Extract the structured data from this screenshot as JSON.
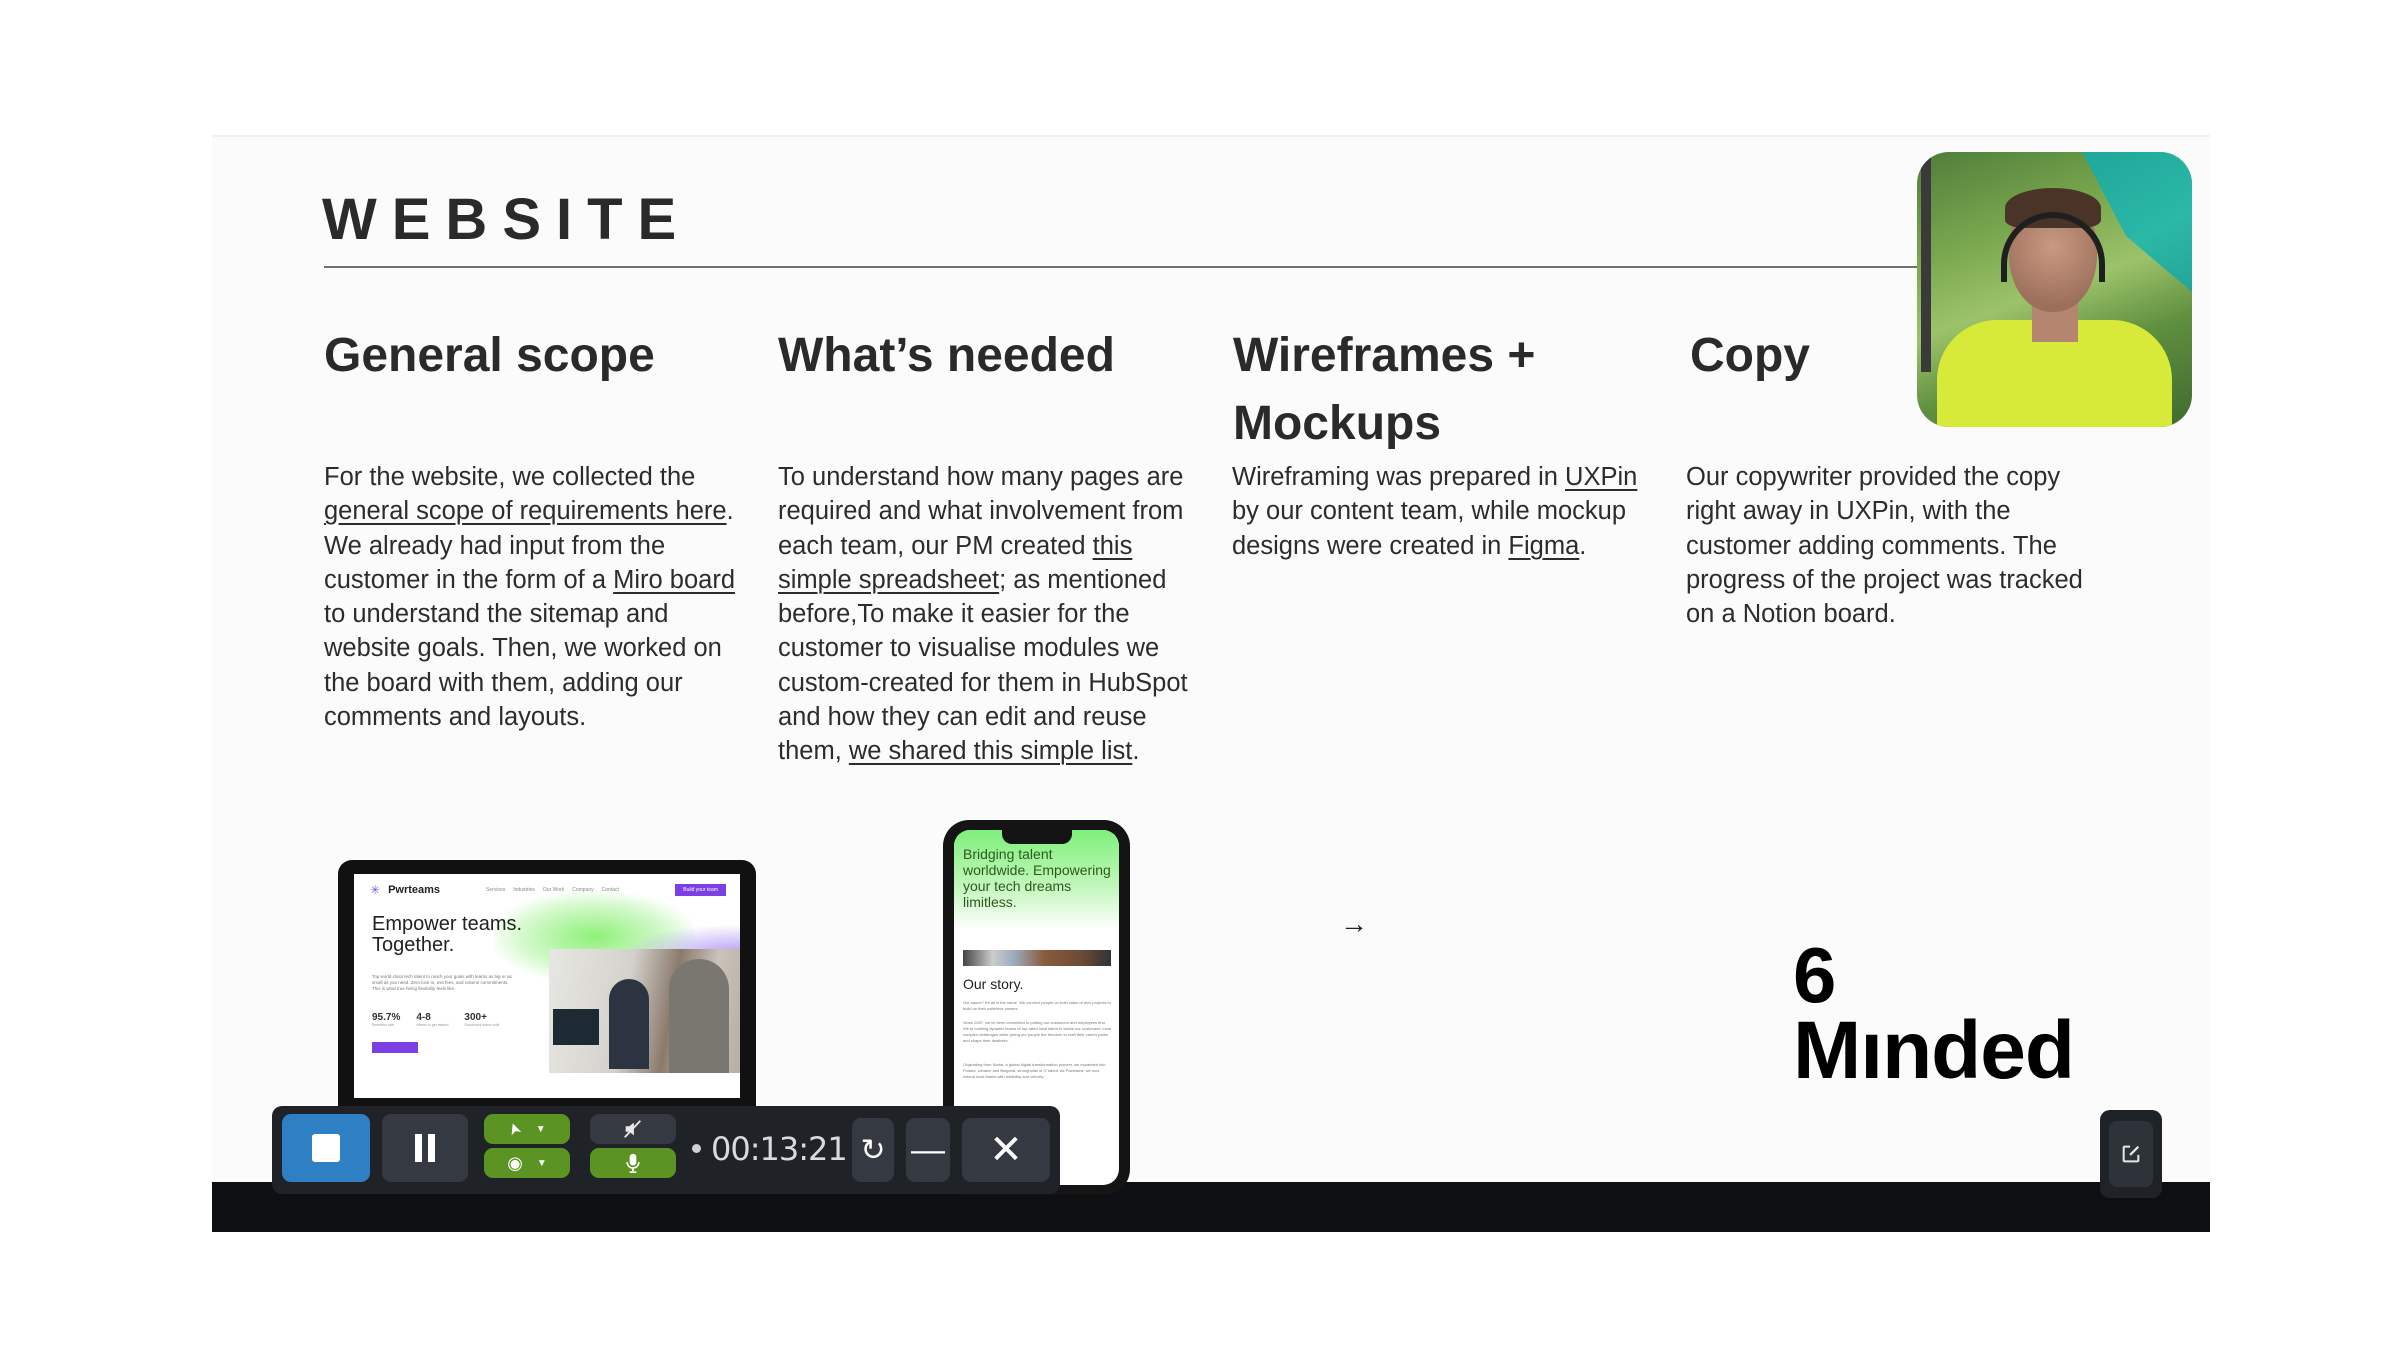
{
  "slide": {
    "title": "WEBSITE",
    "columns": [
      {
        "heading": "General scope",
        "body": [
          {
            "t": "For the website, we collected the "
          },
          {
            "t": "general scope of requirements here",
            "link": true
          },
          {
            "t": ". We already had input from the customer in the form of a "
          },
          {
            "t": "Miro board",
            "link": true
          },
          {
            "t": " to understand the sitemap and website goals. Then, we worked on the board with them, adding our comments and layouts."
          }
        ]
      },
      {
        "heading": "What’s needed",
        "body": [
          {
            "t": "To understand how many pages are required and what involvement from each team, our PM created "
          },
          {
            "t": "this simple spreadsheet",
            "link": true
          },
          {
            "t": "; as mentioned before,To make it easier for the customer to visualise modules we custom-created for them in HubSpot and how they can edit and reuse them, "
          },
          {
            "t": "we shared this simple list",
            "link": true
          },
          {
            "t": "."
          }
        ]
      },
      {
        "heading": "Wireframes + Mockups",
        "body": [
          {
            "t": "Wireframing was prepared in "
          },
          {
            "t": "UXPin",
            "link": true
          },
          {
            "t": " by our content team, while mockup designs were created in "
          },
          {
            "t": "Figma",
            "link": true,
            "blue": true
          },
          {
            "t": "."
          }
        ]
      },
      {
        "heading": "Copy",
        "body": [
          {
            "t": "Our copywriter provided the copy right away in UXPin, with the customer adding comments. The progress of the project was tracked on a Notion board."
          }
        ]
      }
    ],
    "laptop_mockup": {
      "brand": "Pwrteams",
      "nav": [
        "Services",
        "Industries",
        "Our Work",
        "Company",
        "Contact"
      ],
      "cta": "Build your team",
      "hero_line1": "Empower teams.",
      "hero_line2": "Together.",
      "blurb": "Top world-class tech talent to reach your goals with teams as big or as small as you need. Zero lock-in, exit fees, and volume commitments. This is what true hiring flexibility feels like.",
      "stats": [
        {
          "value": "95.7%",
          "label": "Retention rate"
        },
        {
          "value": "4-8",
          "label": "Weeks to get started"
        },
        {
          "value": "300+",
          "label": "Successful teams built"
        }
      ]
    },
    "phone_mockup": {
      "tagline": "Bridging talent worldwide. Empowering your tech dreams limitless.",
      "section_title": "Our story.",
      "paragraphs": [
        "Our sauce? It's all in the name. We connect people on both sides of tech projects to build on their collective powers.",
        "Since 2007, we've been committed to putting our customers and employees first. We're building dynamic teams of top-rated local talent to tackle our customers' most complex challenges while giving our people the freedom to craft their career paths and shape their destinies.",
        "Originating from Nortal, a global digital transformation pioneer, we expanded into Poland, Ukraine and Bulgaria, strongholds of IT talent. As Pwrteams, we now extend local teams with reliability and velocity."
      ]
    },
    "logo": {
      "line1": "6",
      "line2": "Mınded"
    },
    "arrow_icon": "→"
  },
  "webcam": {
    "label": "presenter-webcam"
  },
  "recorder_toolbar": {
    "timer": "00:13:21",
    "stop_color": "#2f7fc5",
    "active_color": "#5b9423",
    "icons": {
      "stop": "■",
      "cursor": "➤",
      "caret": "▼",
      "webcam": "◉",
      "speaker_muted": "🔇",
      "mic": "🎤",
      "restart": "↻",
      "minimize": "—",
      "close": "✕"
    }
  },
  "edit_button": {
    "icon": "edit-icon"
  }
}
